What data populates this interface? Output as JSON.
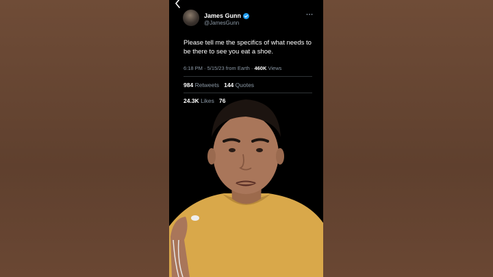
{
  "tweet": {
    "author_name": "James Gunn",
    "author_handle": "@JamesGunn",
    "text": "Please tell me the specifics of what needs to be there to see you eat a shoe.",
    "time": "6:18 PM",
    "date": "5/15/23",
    "source": "from Earth",
    "separator": "·",
    "views_count": "460K",
    "views_label": "Views",
    "retweets_count": "984",
    "retweets_label": "Retweets",
    "quotes_count": "144",
    "quotes_label": "Quotes",
    "likes_count": "24.3K",
    "likes_label": "Likes",
    "bookmarks_count": "76"
  },
  "icons": {
    "back": "chevron-left-icon",
    "verified": "verified-badge-icon",
    "more": "more-horizontal-icon"
  },
  "colors": {
    "background": "#000000",
    "verified": "#1d9bf0",
    "secondary_text": "#8b98a5",
    "side_background": "#6b4a35",
    "shirt": "#d9a84a"
  }
}
